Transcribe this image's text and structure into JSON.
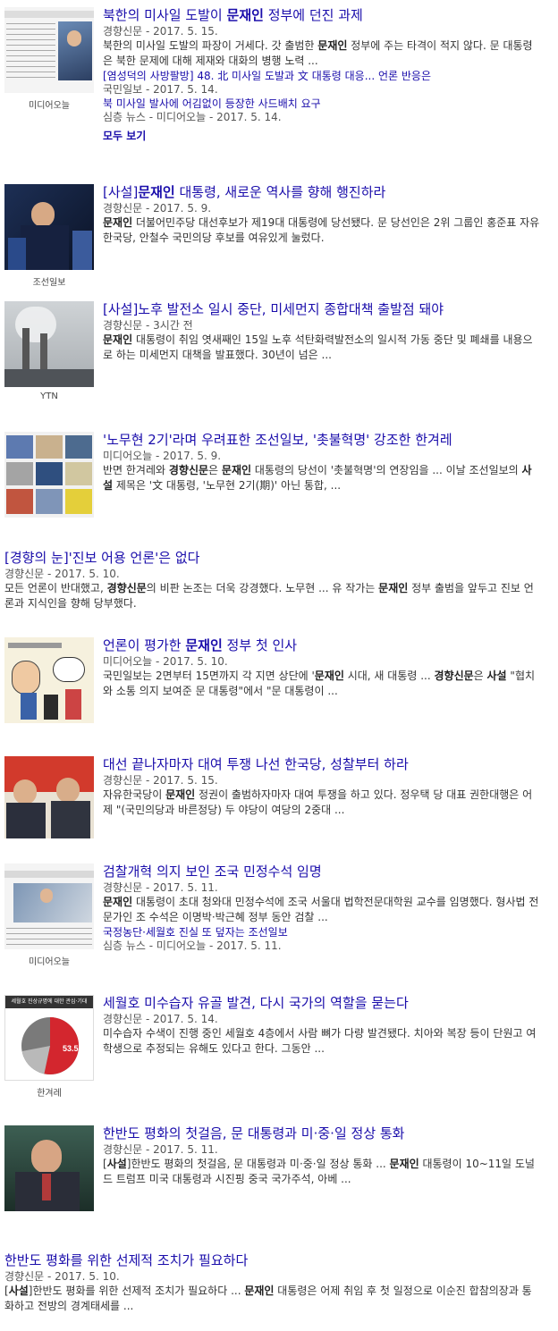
{
  "results": [
    {
      "title_parts": [
        {
          "t": "북한의 미사일 도발이 ",
          "b": false
        },
        {
          "t": "문재인",
          "b": true
        },
        {
          "t": " 정부에 던진 과제",
          "b": false
        }
      ],
      "source": "경향신문",
      "date": "- 2017. 5. 15.",
      "snippet_parts": [
        {
          "t": "북한의 미사일 도발의 파장이 거세다. 갓 출범한 ",
          "b": false
        },
        {
          "t": "문재인",
          "b": true
        },
        {
          "t": " 정부에 주는 타격이 적지 않다. 문 대통령은 북한 문제에 대해 제재와 대화의 병행 노력 ...",
          "b": false
        }
      ],
      "thumb_caption": "미디어오늘",
      "sub": [
        {
          "title": "[염성덕의 사방팔방] 48. 北 미사일 도발과 文 대통령 대응... 언론 반응은",
          "meta": "국민일보 - 2017. 5. 14."
        },
        {
          "title": "북 미사일 발사에 어김없이 등장한 사드배치 요구",
          "meta": "심층 뉴스 - 미디어오늘 - 2017. 5. 14."
        }
      ],
      "more": "모두 보기"
    },
    {
      "title_parts": [
        {
          "t": "[사설]",
          "b": false
        },
        {
          "t": "문재인",
          "b": true
        },
        {
          "t": " 대통령, 새로운 역사를 향해 행진하라",
          "b": false
        }
      ],
      "source": "경향신문",
      "date": "- 2017. 5. 9.",
      "snippet_parts": [
        {
          "t": "문재인",
          "b": true
        },
        {
          "t": " 더불어민주당 대선후보가 제19대 대통령에 당선됐다. 문 당선인은 2위 그룹인 홍준표 자유한국당, 안철수 국민의당 후보를 여유있게 눌렀다.",
          "b": false
        }
      ],
      "thumb_caption": "조선일보"
    },
    {
      "title_parts": [
        {
          "t": "[사설]노후 발전소 일시 중단, 미세먼지 종합대책 출발점 돼야",
          "b": false
        }
      ],
      "source": "경향신문",
      "date": "- 3시간 전",
      "snippet_parts": [
        {
          "t": "문재인",
          "b": true
        },
        {
          "t": " 대통령이 취임 엿새째인 15일 노후 석탄화력발전소의 일시적 가동 중단 및 폐쇄를 내용으로 하는 미세먼지 대책을 발표했다. 30년이 넘은 ...",
          "b": false
        }
      ],
      "thumb_caption": "YTN"
    },
    {
      "title_parts": [
        {
          "t": "'노무현 2기'라며 우려표한 조선일보, '촛불혁명' 강조한 한겨레",
          "b": false
        }
      ],
      "source": "미디어오늘",
      "date": "- 2017. 5. 9.",
      "snippet_parts": [
        {
          "t": "반면 한겨레와 ",
          "b": false
        },
        {
          "t": "경향신문",
          "b": true
        },
        {
          "t": "은 ",
          "b": false
        },
        {
          "t": "문재인",
          "b": true
        },
        {
          "t": " 대통령의 당선이 '촛불혁명'의 연장임을 ... 이날 조선일보의 ",
          "b": false
        },
        {
          "t": "사설",
          "b": true
        },
        {
          "t": " 제목은 '文 대통령, '노무현 2기(期)' 아닌 통합, ...",
          "b": false
        }
      ],
      "thumb_caption": ""
    },
    {
      "title_parts": [
        {
          "t": "[경향의 눈]'진보 어용 언론'은 없다",
          "b": false
        }
      ],
      "source": "경향신문",
      "date": "- 2017. 5. 10.",
      "snippet_parts": [
        {
          "t": "모든 언론이 반대했고, ",
          "b": false
        },
        {
          "t": "경향신문",
          "b": true
        },
        {
          "t": "의 비판 논조는 더욱 강경했다. 노무현 ... 유 작가는 ",
          "b": false
        },
        {
          "t": "문재인",
          "b": true
        },
        {
          "t": " 정부 출범을 앞두고 진보 언론과 지식인을 향해 당부했다.",
          "b": false
        }
      ]
    },
    {
      "title_parts": [
        {
          "t": "언론이 평가한 ",
          "b": false
        },
        {
          "t": "문재인",
          "b": true
        },
        {
          "t": " 정부 첫 인사",
          "b": false
        }
      ],
      "source": "미디어오늘",
      "date": "- 2017. 5. 10.",
      "snippet_parts": [
        {
          "t": "국민일보는 2면부터 15면까지 각 지면 상단에 '",
          "b": false
        },
        {
          "t": "문재인",
          "b": true
        },
        {
          "t": " 시대, 새 대통령 ... ",
          "b": false
        },
        {
          "t": "경향신문",
          "b": true
        },
        {
          "t": "은 ",
          "b": false
        },
        {
          "t": "사설",
          "b": true
        },
        {
          "t": " \"협치와 소통 의지 보여준 문 대통령\"에서 \"문 대통령이 ...",
          "b": false
        }
      ],
      "thumb_caption": ""
    },
    {
      "title_parts": [
        {
          "t": "대선 끝나자마자 대여 투쟁 나선 한국당, 성찰부터 하라",
          "b": false
        }
      ],
      "source": "경향신문",
      "date": "- 2017. 5. 15.",
      "snippet_parts": [
        {
          "t": "자유한국당이 ",
          "b": false
        },
        {
          "t": "문재인",
          "b": true
        },
        {
          "t": " 정권이 출범하자마자 대여 투쟁을 하고 있다. 정우택 당 대표 권한대행은 어제 \"(국민의당과 바른정당) 두 야당이 여당의 2중대 ...",
          "b": false
        }
      ],
      "thumb_caption": ""
    },
    {
      "title_parts": [
        {
          "t": "검찰개혁 의지 보인 조국 민정수석 임명",
          "b": false
        }
      ],
      "source": "경향신문",
      "date": "- 2017. 5. 11.",
      "snippet_parts": [
        {
          "t": "문재인",
          "b": true
        },
        {
          "t": " 대통령이 초대 청와대 민정수석에 조국 서울대 법학전문대학원 교수를 임명했다. 형사법 전문가인 조 수석은 이명박·박근혜 정부 동안 검찰 ...",
          "b": false
        }
      ],
      "thumb_caption": "미디어오늘",
      "sub": [
        {
          "title": "국정농단·세월호 진실 또 덮자는 조선일보",
          "meta": "심층 뉴스 - 미디어오늘 - 2017. 5. 11."
        }
      ]
    },
    {
      "title_parts": [
        {
          "t": "세월호 미수습자 유골 발견, 다시 국가의 역할을 묻는다",
          "b": false
        }
      ],
      "source": "경향신문",
      "date": "- 2017. 5. 14.",
      "snippet_parts": [
        {
          "t": "미수습자 수색이 진행 중인 세월호 4층에서 사람 뼈가 다량 발견됐다. 치아와 복장 등이 단원고 여학생으로 추정되는 유해도 있다고 한다. 그동안 ...",
          "b": false
        }
      ],
      "thumb_caption": "한겨레",
      "pie": {
        "title": "세월호 진상규명에 대한 관심·기대",
        "value": "53.5"
      }
    },
    {
      "title_parts": [
        {
          "t": "한반도 평화의 첫걸음, 문 대통령과 미·중·일 정상 통화",
          "b": false
        }
      ],
      "source": "경향신문",
      "date": "- 2017. 5. 11.",
      "snippet_parts": [
        {
          "t": "[",
          "b": false
        },
        {
          "t": "사설",
          "b": true
        },
        {
          "t": "]한반도 평화의 첫걸음, 문 대통령과 미·중·일 정상 통화 ... ",
          "b": false
        },
        {
          "t": "문재인",
          "b": true
        },
        {
          "t": " 대통령이 10~11일 도널드 트럼프 미국 대통령과 시진핑 중국 국가주석, 아베 ...",
          "b": false
        }
      ],
      "thumb_caption": ""
    },
    {
      "title_parts": [
        {
          "t": "한반도 평화를 위한 선제적 조치가 필요하다",
          "b": false
        }
      ],
      "source": "경향신문",
      "date": "- 2017. 5. 10.",
      "snippet_parts": [
        {
          "t": "[",
          "b": false
        },
        {
          "t": "사설",
          "b": true
        },
        {
          "t": "]한반도 평화를 위한 선제적 조치가 필요하다 ... ",
          "b": false
        },
        {
          "t": "문재인",
          "b": true
        },
        {
          "t": " 대통령은 어제 취임 후 첫 일정으로 이순진 합참의장과 통화하고 전방의 경계태세를 ...",
          "b": false
        }
      ]
    }
  ]
}
